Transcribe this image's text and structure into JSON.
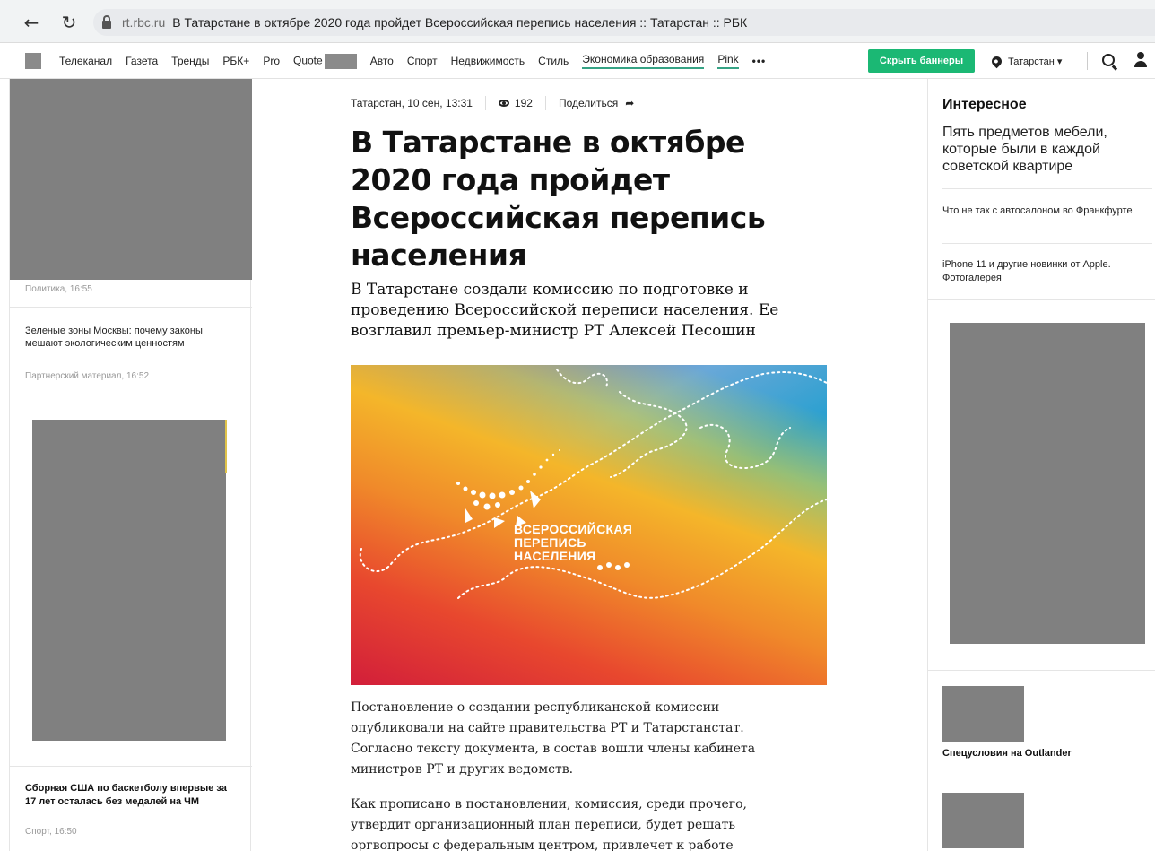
{
  "browser": {
    "domain": "rt.rbc.ru",
    "title": "В Татарстане в октябре 2020 года пройдет Всероссийская перепись населения :: Татарстан :: РБК",
    "back_icon": "←",
    "reload_icon": "↻"
  },
  "header": {
    "menu": [
      "Телеканал",
      "Газета",
      "Тренды",
      "РБК+",
      "Pro",
      "Quote",
      "Авто",
      "Спорт",
      "Недвижимость",
      "Стиль",
      "Экономика образования",
      "Pink"
    ],
    "more": "•••",
    "hide_banners": "Скрыть баннеры",
    "region": "Татарстан ▾",
    "accent_color": "#1bb874"
  },
  "left": {
    "meta1": "Политика, 16:55",
    "news1": "Зеленые зоны Москвы: почему законы мешают экологическим ценностям",
    "news1_meta": "Партнерский материал, 16:52",
    "news2": "Сборная США по баскетболу впервые за 17 лет осталась без медалей на ЧМ",
    "news2_meta": "Спорт, 16:50"
  },
  "article": {
    "date": "Татарстан, 10 сен, 13:31",
    "views": "192",
    "share": "Поделиться",
    "title": "В Татарстане в октябре 2020 года пройдет Всероссийская перепись населения",
    "lead": "В Татарстане создали комиссию по подготовке и проведению Всероссийской переписи населения. Ее возглавил премьер-министр РТ Алексей Песошин",
    "image_text": [
      "ВСЕРОССИЙСКАЯ",
      "ПЕРЕПИСЬ",
      "НАСЕЛЕНИЯ"
    ],
    "p1": "Постановление о создании республиканской комиссии опубликовали на сайте правительства РТ и Татарстанстат. Согласно тексту документа, в состав вошли члены кабинета министров РТ и других ведомств.",
    "p2": "Как прописано в постановлении, комиссия, среди прочего, утвердит организационный план переписи, будет решать оргвопросы с федеральным центром, привлечет к работе"
  },
  "right": {
    "heading": "Интересное",
    "main": "Пять предметов мебели, которые были в каждой советской квартире",
    "item1": "Что не так с автосалоном во Франкфурте",
    "item2": "iPhone 11 и другие новинки от Apple. Фотогалерея",
    "promo": "Спецусловия на Outlander"
  }
}
